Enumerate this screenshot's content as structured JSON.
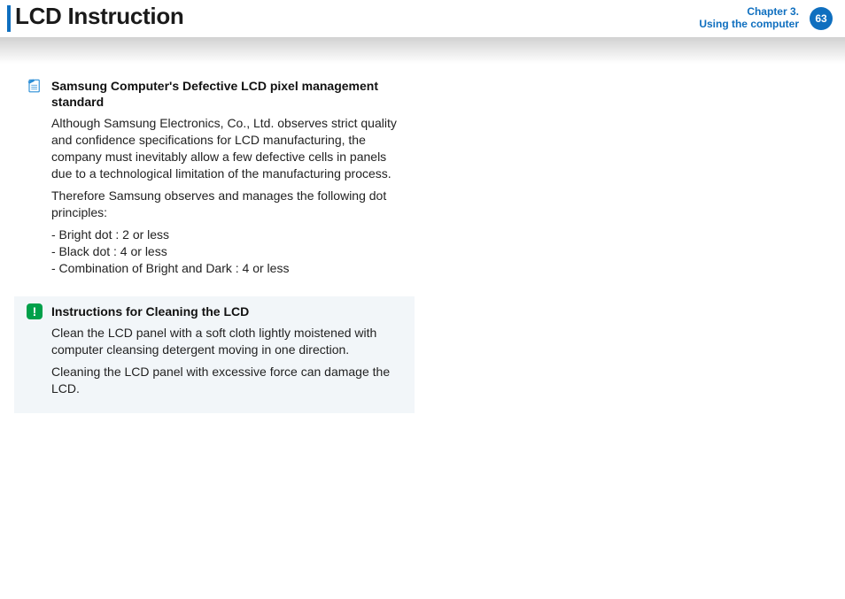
{
  "header": {
    "title": "LCD Instruction",
    "chapter_line1": "Chapter 3.",
    "chapter_line2": "Using the computer",
    "page_number": "63"
  },
  "notes": {
    "note1": {
      "title": "Samsung Computer's Defective LCD pixel management standard",
      "para1": "Although Samsung Electronics, Co., Ltd. observes strict quality and confidence specifications for LCD manufacturing, the company must inevitably allow a few defective cells in panels due to a technological limitation of the manufacturing process.",
      "para2": "Therefore Samsung observes and manages the following dot principles:",
      "bullets": [
        "- Bright dot : 2 or less",
        "- Black dot  : 4 or less",
        "- Combination of Bright and Dark : 4 or less"
      ]
    },
    "note2": {
      "title": "Instructions for Cleaning the LCD",
      "para1": "Clean the LCD panel with a soft cloth lightly moistened with computer cleansing detergent moving in one direction.",
      "para2": "Cleaning the LCD panel with excessive force can damage the LCD."
    }
  }
}
